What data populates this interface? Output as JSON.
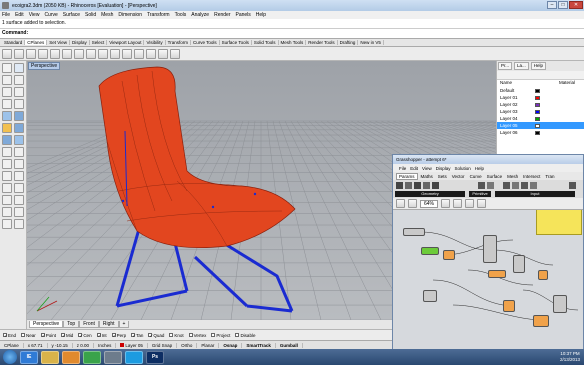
{
  "window": {
    "title": "ecoigra2.3dm (2050 KB) - Rhinoceros [Evaluation] - [Perspective]",
    "buttons": {
      "minimize": "–",
      "maximize": "□",
      "close": "✕"
    }
  },
  "menu": [
    "File",
    "Edit",
    "View",
    "Curve",
    "Surface",
    "Solid",
    "Mesh",
    "Dimension",
    "Transform",
    "Tools",
    "Analyze",
    "Render",
    "Panels",
    "Help"
  ],
  "command": {
    "history": "1 surface added to selection.",
    "prompt": "Command:"
  },
  "toolbar_tabs": [
    "Standard",
    "CPlanes",
    "Set View",
    "Display",
    "Select",
    "Viewport Layout",
    "Visibility",
    "Transform",
    "Curve Tools",
    "Surface Tools",
    "Solid Tools",
    "Mesh Tools",
    "Render Tools",
    "Drafting",
    "New in V5"
  ],
  "active_toolbar_tab": "CPlanes",
  "viewport": {
    "label": "Perspective",
    "tabs": [
      "Perspective",
      "Top",
      "Front",
      "Right"
    ],
    "add_tab": "+",
    "chair_color": "#e2461f",
    "leg_color": "#1a2bd1"
  },
  "osnap": [
    {
      "label": "End",
      "checked": true
    },
    {
      "label": "Near",
      "checked": false
    },
    {
      "label": "Point",
      "checked": true
    },
    {
      "label": "Mid",
      "checked": true
    },
    {
      "label": "Cen",
      "checked": true
    },
    {
      "label": "Int",
      "checked": true
    },
    {
      "label": "Perp",
      "checked": true
    },
    {
      "label": "Tan",
      "checked": true
    },
    {
      "label": "Quad",
      "checked": true
    },
    {
      "label": "Knot",
      "checked": false
    },
    {
      "label": "Vertex",
      "checked": false
    },
    {
      "label": "Project",
      "checked": false
    },
    {
      "label": "Disable",
      "checked": false
    }
  ],
  "status": {
    "cplane": "CPlane",
    "x": "x 67.71",
    "y": "y -10.15",
    "z": "z 0.00",
    "units": "Inches",
    "layer": "Layer 05",
    "grid_snap": "Grid Snap",
    "ortho": "Ortho",
    "planar": "Planar",
    "osnap": "Osnap",
    "smarttrack": "SmartTrack",
    "gumball": "Gumball"
  },
  "layers_panel": {
    "tabs": [
      "Pr...",
      "La...",
      "Help"
    ],
    "header_name": "Name",
    "header_material": "Material",
    "rows": [
      {
        "name": "Default",
        "color": "#000000",
        "selected": false
      },
      {
        "name": "Layer 01",
        "color": "#ff0000",
        "selected": false
      },
      {
        "name": "Layer 02",
        "color": "#7a2fbf",
        "selected": false
      },
      {
        "name": "Layer 03",
        "color": "#0000ff",
        "selected": false
      },
      {
        "name": "Layer 04",
        "color": "#00aa00",
        "selected": false
      },
      {
        "name": "Layer 05",
        "color": "#ffffff",
        "selected": true
      },
      {
        "name": "Layer 06",
        "color": "#000000",
        "selected": false
      }
    ]
  },
  "grasshopper": {
    "title": "Grasshopper - attempt 6*",
    "menu": [
      "File",
      "Edit",
      "View",
      "Display",
      "Solution",
      "Help"
    ],
    "tabs": [
      "Params",
      "Maths",
      "Sets",
      "Vector",
      "Curve",
      "Surface",
      "Mesh",
      "Intersect",
      "Tran"
    ],
    "active_tab": "Params",
    "ribbon_groups": [
      "Geometry",
      "Primitive",
      "Input"
    ],
    "zoom": "64%"
  },
  "taskbar": {
    "time": "10:37 PM",
    "date": "2/13/2013",
    "apps": [
      "IE",
      "Explorer",
      "Media",
      "Chrome",
      "Rhino",
      "Skype",
      "Photoshop"
    ]
  }
}
